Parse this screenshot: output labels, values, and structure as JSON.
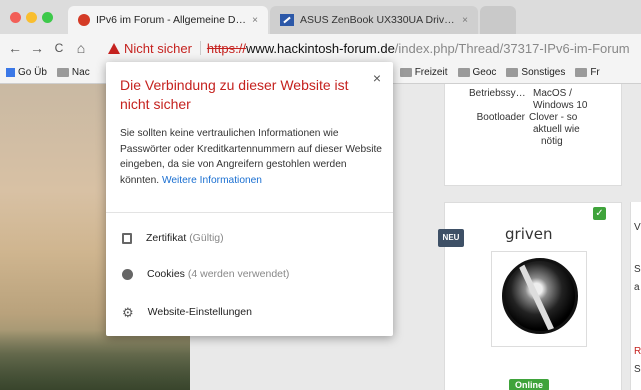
{
  "tabs": [
    {
      "title": "IPv6 im Forum - Allgemeine D…",
      "close": "×"
    },
    {
      "title": "ASUS ZenBook UX330UA Driv…",
      "close": "×"
    }
  ],
  "toolbar": {
    "back": "←",
    "forward": "→",
    "reload": "C",
    "home": "⌂",
    "security_label": "Nicht sicher",
    "url_scheme": "https://",
    "url_host": "www.hackintosh-forum.de",
    "url_path": "/index.php/Thread/37317-IPv6-im-Forum"
  },
  "bookmarks": [
    {
      "label": "Go Üb"
    },
    {
      "label": "Nac"
    },
    {
      "label": "Freizeit"
    },
    {
      "label": "Geoc"
    },
    {
      "label": "Sonstiges"
    },
    {
      "label": "Fr"
    }
  ],
  "popup": {
    "title": "Die Verbindung zu dieser Website ist nicht sicher",
    "close": "×",
    "body": "Sie sollten keine vertraulichen Informationen wie Passwörter oder Kreditkartennummern auf dieser Website eingeben, da sie von Angreifern gestohlen werden könnten.",
    "link": "Weitere Informationen",
    "certificate": "Zertifikat",
    "certificate_status": "(Gültig)",
    "cookies": "Cookies",
    "cookies_status": "(4 werden verwendet)",
    "site_settings": "Website-Einstellungen"
  },
  "post_meta": {
    "label1": "Betriebssy…",
    "value1a": "MacOS /",
    "value1b": "Windows 10",
    "label2": "Bootloader",
    "value2a": "Clover - so",
    "value2b": "aktuell wie",
    "value2c": "nötig"
  },
  "user": {
    "badge": "NEU",
    "name": "griven",
    "status": "Online"
  },
  "side": {
    "t1": "V",
    "t2": "S",
    "t3": "a",
    "t4": "R",
    "t5": "S"
  }
}
